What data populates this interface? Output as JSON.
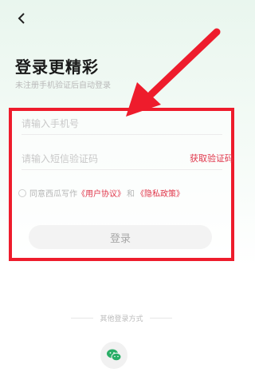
{
  "header": {
    "back_icon": "chevron-left-icon"
  },
  "title": "登录更精彩",
  "subtitle": "未注册手机验证后自动登录",
  "form": {
    "phone_placeholder": "请输入手机号",
    "code_placeholder": "请输入短信验证码",
    "get_code_label": "获取验证码",
    "agree_prefix": "同意西瓜写作",
    "user_agreement": "《用户协议》",
    "and_text": "和",
    "privacy_policy": "《隐私政策》",
    "login_label": "登录"
  },
  "other_login": {
    "label": "其他登录方式",
    "wechat_icon": "wechat-icon"
  },
  "colors": {
    "highlight_box": "#ee1c2c",
    "arrow": "#ee1c2c",
    "link": "#e0364a",
    "wechat": "#2aae67"
  }
}
